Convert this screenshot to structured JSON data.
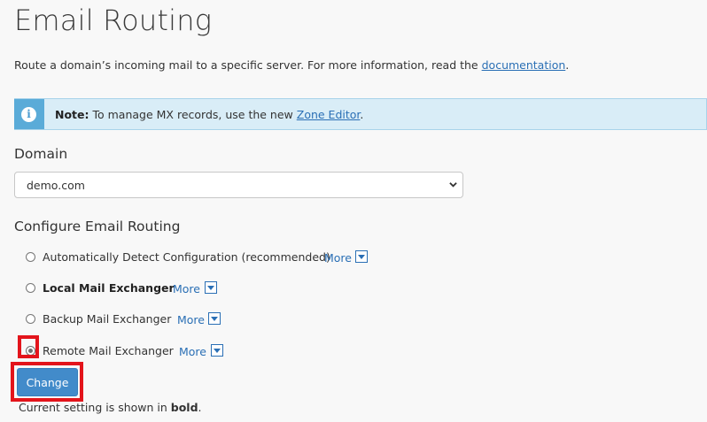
{
  "page": {
    "title": "Email Routing",
    "intro_text": "Route a domain’s incoming mail to a specific server. For more information, read the ",
    "intro_link": "documentation",
    "intro_end": "."
  },
  "note": {
    "icon": "info-icon",
    "label": "Note:",
    "text": " To manage MX records, use the new ",
    "link": "Zone Editor",
    "end": "."
  },
  "domain": {
    "heading": "Domain",
    "selected": "demo.com"
  },
  "routing": {
    "heading": "Configure Email Routing",
    "options": [
      {
        "label": "Automatically Detect Configuration (recommended)",
        "more": "More",
        "checked": false,
        "bold": false
      },
      {
        "label": "Local Mail Exchanger",
        "more": "More",
        "checked": false,
        "bold": true
      },
      {
        "label": "Backup Mail Exchanger",
        "more": "More",
        "checked": false,
        "bold": false
      },
      {
        "label": "Remote Mail Exchanger",
        "more": "More",
        "checked": true,
        "bold": false
      }
    ]
  },
  "actions": {
    "change_label": "Change"
  },
  "footer": {
    "text": "Current setting is shown in ",
    "bold_word": "bold",
    "end": "."
  },
  "colors": {
    "accent": "#428bca",
    "link": "#2a6fb5",
    "note_bg": "#d9edf7",
    "note_bar": "#5aabd8",
    "highlight": "#e3141b"
  }
}
